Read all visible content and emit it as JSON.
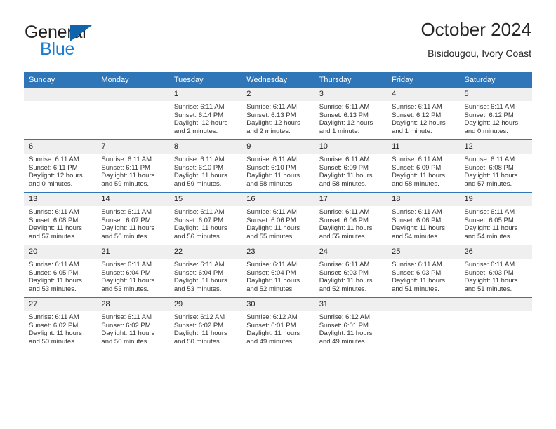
{
  "brand": {
    "name_part1": "General",
    "name_part2": "Blue",
    "triangle_icon": "triangle-icon",
    "color_dark": "#231f20",
    "color_blue": "#1a7fd4",
    "color_triangle": "#1064ab"
  },
  "header": {
    "title": "October 2024",
    "subtitle": "Bisidougou, Ivory Coast"
  },
  "theme": {
    "header_row_bg": "#2f76b8",
    "header_row_text": "#ffffff",
    "daynum_bg": "#efefef",
    "cell_bg": "#ffffff",
    "separator": "#2f76b8"
  },
  "weekday_headers": [
    "Sunday",
    "Monday",
    "Tuesday",
    "Wednesday",
    "Thursday",
    "Friday",
    "Saturday"
  ],
  "labels": {
    "sunrise_prefix": "Sunrise:",
    "sunset_prefix": "Sunset:",
    "daylight_prefix": "Daylight:"
  },
  "weeks": [
    [
      {
        "day": "",
        "sunrise": "",
        "sunset": "",
        "daylight_line1": "",
        "daylight_line2": "",
        "empty": true
      },
      {
        "day": "",
        "sunrise": "",
        "sunset": "",
        "daylight_line1": "",
        "daylight_line2": "",
        "empty": true
      },
      {
        "day": "1",
        "sunrise": "Sunrise: 6:11 AM",
        "sunset": "Sunset: 6:14 PM",
        "daylight_line1": "Daylight: 12 hours",
        "daylight_line2": "and 2 minutes."
      },
      {
        "day": "2",
        "sunrise": "Sunrise: 6:11 AM",
        "sunset": "Sunset: 6:13 PM",
        "daylight_line1": "Daylight: 12 hours",
        "daylight_line2": "and 2 minutes."
      },
      {
        "day": "3",
        "sunrise": "Sunrise: 6:11 AM",
        "sunset": "Sunset: 6:13 PM",
        "daylight_line1": "Daylight: 12 hours",
        "daylight_line2": "and 1 minute."
      },
      {
        "day": "4",
        "sunrise": "Sunrise: 6:11 AM",
        "sunset": "Sunset: 6:12 PM",
        "daylight_line1": "Daylight: 12 hours",
        "daylight_line2": "and 1 minute."
      },
      {
        "day": "5",
        "sunrise": "Sunrise: 6:11 AM",
        "sunset": "Sunset: 6:12 PM",
        "daylight_line1": "Daylight: 12 hours",
        "daylight_line2": "and 0 minutes."
      }
    ],
    [
      {
        "day": "6",
        "sunrise": "Sunrise: 6:11 AM",
        "sunset": "Sunset: 6:11 PM",
        "daylight_line1": "Daylight: 12 hours",
        "daylight_line2": "and 0 minutes."
      },
      {
        "day": "7",
        "sunrise": "Sunrise: 6:11 AM",
        "sunset": "Sunset: 6:11 PM",
        "daylight_line1": "Daylight: 11 hours",
        "daylight_line2": "and 59 minutes."
      },
      {
        "day": "8",
        "sunrise": "Sunrise: 6:11 AM",
        "sunset": "Sunset: 6:10 PM",
        "daylight_line1": "Daylight: 11 hours",
        "daylight_line2": "and 59 minutes."
      },
      {
        "day": "9",
        "sunrise": "Sunrise: 6:11 AM",
        "sunset": "Sunset: 6:10 PM",
        "daylight_line1": "Daylight: 11 hours",
        "daylight_line2": "and 58 minutes."
      },
      {
        "day": "10",
        "sunrise": "Sunrise: 6:11 AM",
        "sunset": "Sunset: 6:09 PM",
        "daylight_line1": "Daylight: 11 hours",
        "daylight_line2": "and 58 minutes."
      },
      {
        "day": "11",
        "sunrise": "Sunrise: 6:11 AM",
        "sunset": "Sunset: 6:09 PM",
        "daylight_line1": "Daylight: 11 hours",
        "daylight_line2": "and 58 minutes."
      },
      {
        "day": "12",
        "sunrise": "Sunrise: 6:11 AM",
        "sunset": "Sunset: 6:08 PM",
        "daylight_line1": "Daylight: 11 hours",
        "daylight_line2": "and 57 minutes."
      }
    ],
    [
      {
        "day": "13",
        "sunrise": "Sunrise: 6:11 AM",
        "sunset": "Sunset: 6:08 PM",
        "daylight_line1": "Daylight: 11 hours",
        "daylight_line2": "and 57 minutes."
      },
      {
        "day": "14",
        "sunrise": "Sunrise: 6:11 AM",
        "sunset": "Sunset: 6:07 PM",
        "daylight_line1": "Daylight: 11 hours",
        "daylight_line2": "and 56 minutes."
      },
      {
        "day": "15",
        "sunrise": "Sunrise: 6:11 AM",
        "sunset": "Sunset: 6:07 PM",
        "daylight_line1": "Daylight: 11 hours",
        "daylight_line2": "and 56 minutes."
      },
      {
        "day": "16",
        "sunrise": "Sunrise: 6:11 AM",
        "sunset": "Sunset: 6:06 PM",
        "daylight_line1": "Daylight: 11 hours",
        "daylight_line2": "and 55 minutes."
      },
      {
        "day": "17",
        "sunrise": "Sunrise: 6:11 AM",
        "sunset": "Sunset: 6:06 PM",
        "daylight_line1": "Daylight: 11 hours",
        "daylight_line2": "and 55 minutes."
      },
      {
        "day": "18",
        "sunrise": "Sunrise: 6:11 AM",
        "sunset": "Sunset: 6:06 PM",
        "daylight_line1": "Daylight: 11 hours",
        "daylight_line2": "and 54 minutes."
      },
      {
        "day": "19",
        "sunrise": "Sunrise: 6:11 AM",
        "sunset": "Sunset: 6:05 PM",
        "daylight_line1": "Daylight: 11 hours",
        "daylight_line2": "and 54 minutes."
      }
    ],
    [
      {
        "day": "20",
        "sunrise": "Sunrise: 6:11 AM",
        "sunset": "Sunset: 6:05 PM",
        "daylight_line1": "Daylight: 11 hours",
        "daylight_line2": "and 53 minutes."
      },
      {
        "day": "21",
        "sunrise": "Sunrise: 6:11 AM",
        "sunset": "Sunset: 6:04 PM",
        "daylight_line1": "Daylight: 11 hours",
        "daylight_line2": "and 53 minutes."
      },
      {
        "day": "22",
        "sunrise": "Sunrise: 6:11 AM",
        "sunset": "Sunset: 6:04 PM",
        "daylight_line1": "Daylight: 11 hours",
        "daylight_line2": "and 53 minutes."
      },
      {
        "day": "23",
        "sunrise": "Sunrise: 6:11 AM",
        "sunset": "Sunset: 6:04 PM",
        "daylight_line1": "Daylight: 11 hours",
        "daylight_line2": "and 52 minutes."
      },
      {
        "day": "24",
        "sunrise": "Sunrise: 6:11 AM",
        "sunset": "Sunset: 6:03 PM",
        "daylight_line1": "Daylight: 11 hours",
        "daylight_line2": "and 52 minutes."
      },
      {
        "day": "25",
        "sunrise": "Sunrise: 6:11 AM",
        "sunset": "Sunset: 6:03 PM",
        "daylight_line1": "Daylight: 11 hours",
        "daylight_line2": "and 51 minutes."
      },
      {
        "day": "26",
        "sunrise": "Sunrise: 6:11 AM",
        "sunset": "Sunset: 6:03 PM",
        "daylight_line1": "Daylight: 11 hours",
        "daylight_line2": "and 51 minutes."
      }
    ],
    [
      {
        "day": "27",
        "sunrise": "Sunrise: 6:11 AM",
        "sunset": "Sunset: 6:02 PM",
        "daylight_line1": "Daylight: 11 hours",
        "daylight_line2": "and 50 minutes."
      },
      {
        "day": "28",
        "sunrise": "Sunrise: 6:11 AM",
        "sunset": "Sunset: 6:02 PM",
        "daylight_line1": "Daylight: 11 hours",
        "daylight_line2": "and 50 minutes."
      },
      {
        "day": "29",
        "sunrise": "Sunrise: 6:12 AM",
        "sunset": "Sunset: 6:02 PM",
        "daylight_line1": "Daylight: 11 hours",
        "daylight_line2": "and 50 minutes."
      },
      {
        "day": "30",
        "sunrise": "Sunrise: 6:12 AM",
        "sunset": "Sunset: 6:01 PM",
        "daylight_line1": "Daylight: 11 hours",
        "daylight_line2": "and 49 minutes."
      },
      {
        "day": "31",
        "sunrise": "Sunrise: 6:12 AM",
        "sunset": "Sunset: 6:01 PM",
        "daylight_line1": "Daylight: 11 hours",
        "daylight_line2": "and 49 minutes."
      },
      {
        "day": "",
        "sunrise": "",
        "sunset": "",
        "daylight_line1": "",
        "daylight_line2": "",
        "empty": true
      },
      {
        "day": "",
        "sunrise": "",
        "sunset": "",
        "daylight_line1": "",
        "daylight_line2": "",
        "empty": true
      }
    ]
  ]
}
